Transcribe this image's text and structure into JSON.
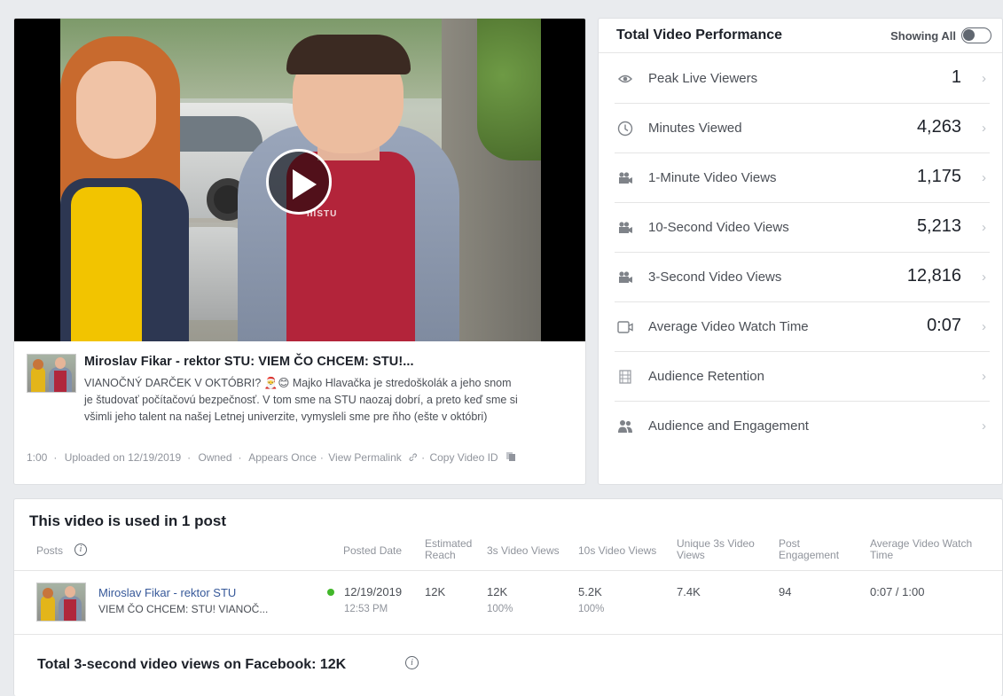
{
  "video": {
    "title": "Miroslav Fikar - rektor STU: VIEM ČO CHCEM: STU!...",
    "description_lines": [
      "VIANOČNÝ DARČEK V OKTÓBRI? 🎅😊 Majko Hlavačka je stredoškolák a jeho snom",
      "je študovať počítačovú bezpečnosť. V tom sme na STU naozaj dobrí, a preto keď sme si",
      "všimli jeho talent na našej Letnej univerzite, vymysleli sme pre ňho (ešte v októbri)"
    ],
    "shirt_logo": "IIISTU",
    "meta": {
      "duration": "1:00",
      "uploaded": "Uploaded on 12/19/2019",
      "owned": "Owned",
      "appears": "Appears Once",
      "permalink": "View Permalink",
      "copy_id": "Copy Video ID",
      "separator": "·"
    }
  },
  "performance": {
    "title": "Total Video Performance",
    "toggle_label": "Showing All",
    "toggle_on": false,
    "chevron": "›",
    "metrics": [
      {
        "icon": "eye-icon",
        "label": "Peak Live Viewers",
        "value": "1"
      },
      {
        "icon": "clock-icon",
        "label": "Minutes Viewed",
        "value": "4,263"
      },
      {
        "icon": "video-camera-icon",
        "label": "1-Minute Video Views",
        "value": "1,175"
      },
      {
        "icon": "video-camera-icon",
        "label": "10-Second Video Views",
        "value": "5,213"
      },
      {
        "icon": "video-camera-icon",
        "label": "3-Second Video Views",
        "value": "12,816"
      },
      {
        "icon": "video-outline-icon",
        "label": "Average Video Watch Time",
        "value": "0:07"
      },
      {
        "icon": "film-icon",
        "label": "Audience Retention",
        "value": ""
      },
      {
        "icon": "people-icon",
        "label": "Audience and Engagement",
        "value": ""
      }
    ]
  },
  "posts": {
    "title": "This video is used in 1 post",
    "info_glyph": "i",
    "columns": {
      "posts": "Posts",
      "posted_date": "Posted Date",
      "reach_1": "Estimated",
      "reach_2": "Reach",
      "views_3s": "3s Video Views",
      "views_10s": "10s Video Views",
      "unique_1": "Unique 3s Video",
      "unique_2": "Views",
      "engagement_1": "Post",
      "engagement_2": "Engagement",
      "avg_1": "Average Video Watch",
      "avg_2": "Time"
    },
    "row": {
      "author": "Miroslav Fikar - rektor STU",
      "snippet": "VIEM ČO CHCEM: STU! VIANOČ...",
      "date": "12/19/2019",
      "time": "12:53 PM",
      "reach": "12K",
      "views_3s": "12K",
      "views_3s_pct": "100%",
      "views_10s": "5.2K",
      "views_10s_pct": "100%",
      "unique_3s": "7.4K",
      "engagement": "94",
      "avg_watch": "0:07 / 1:00"
    },
    "total_label": "Total 3-second video views on Facebook: 12K"
  }
}
